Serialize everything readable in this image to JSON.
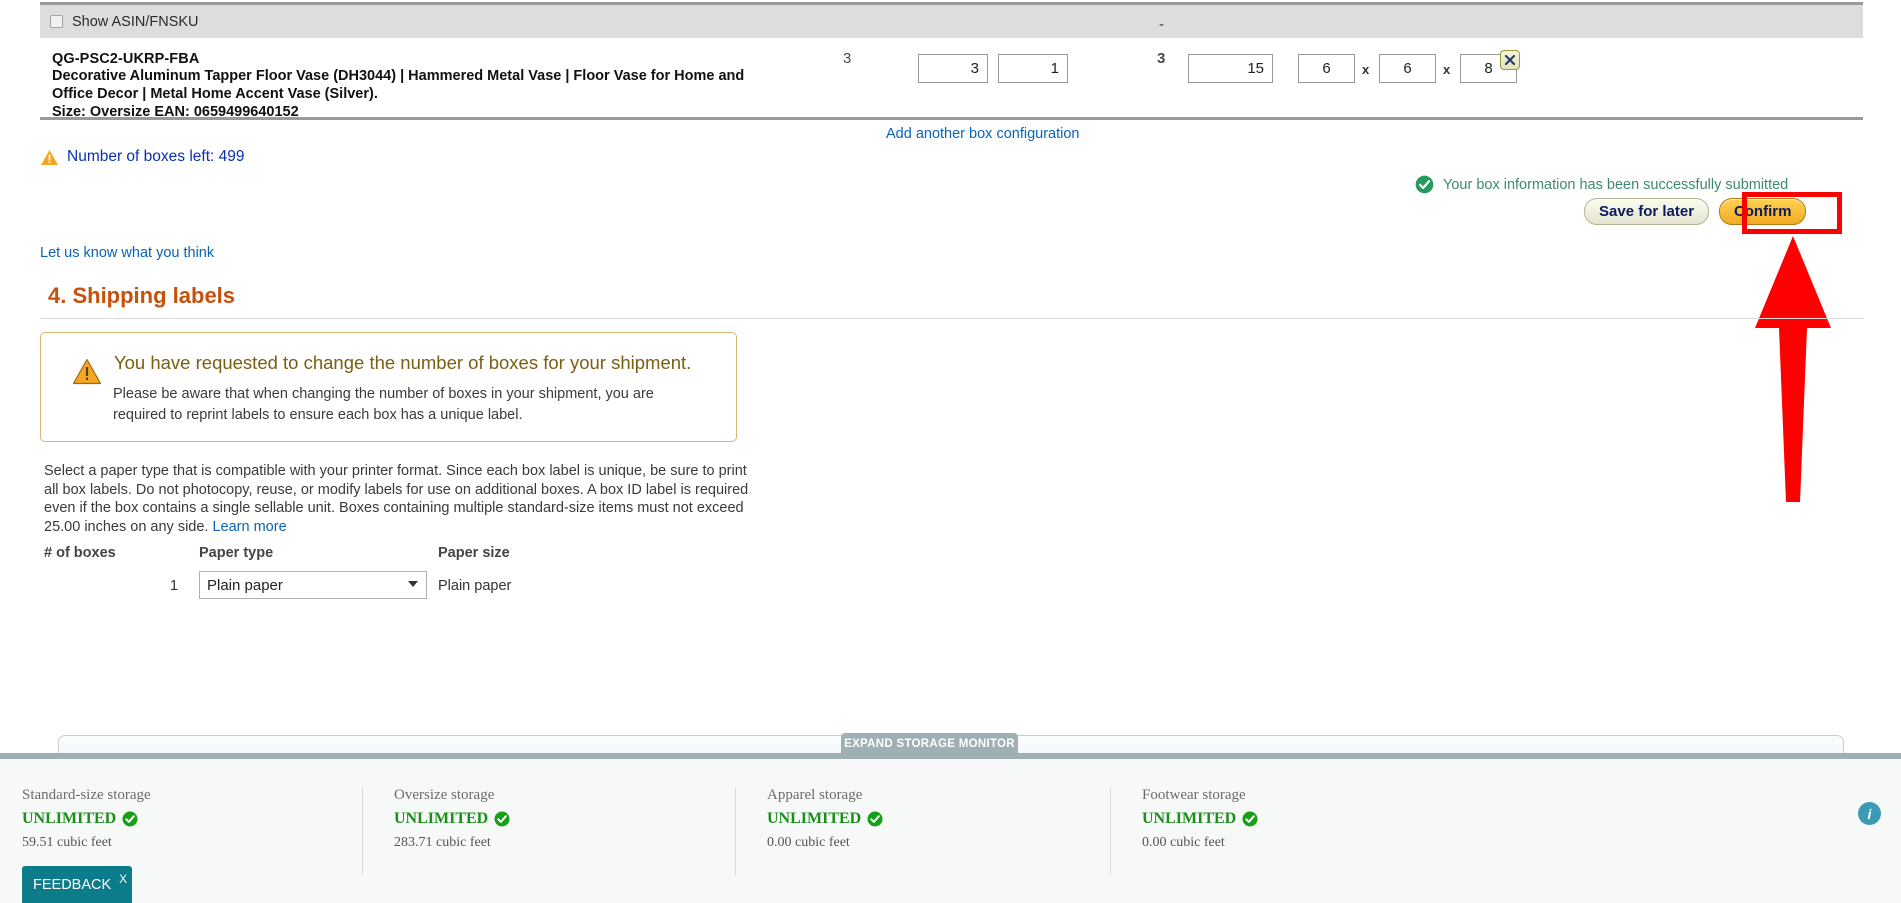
{
  "header_row": {
    "show_asin_label": "Show ASIN/FNSKU",
    "dash": "-"
  },
  "product_row": {
    "sku": "QG-PSC2-UKRP-FBA",
    "title": "Decorative Aluminum Tapper Floor Vase (DH3044) | Hammered Metal Vase | Floor Vase for Home and Office Decor | Metal Home Accent Vase (Silver).",
    "size_line": "Size: Oversize EAN: 0659499640152",
    "boxes_total": "3",
    "boxes_qty": "3",
    "units_per_box": "1",
    "add_config_link": "Add another box configuration",
    "units_total": "3",
    "weight": "15",
    "dim_length": "6",
    "dim_width": "6",
    "dim_height": "8",
    "x_sep": "x",
    "delete_title": "Remove box configuration"
  },
  "boxes_left": {
    "text": "Number of boxes left: 499"
  },
  "status": {
    "success_text": "Your box information has been successfully submitted"
  },
  "actions": {
    "save_for_later": "Save for later",
    "confirm": "Confirm"
  },
  "feedback_link": "Let us know what you think",
  "section4": {
    "title": "4. Shipping labels",
    "alert": {
      "heading": "You have requested to change the number of boxes for your shipment.",
      "body": "Please be aware that when changing the number of boxes in your shipment, you are required to reprint labels to ensure each box has a unique label."
    },
    "paragraph": "Select a paper type that is compatible with your printer format. Since each box label is unique, be sure to print all box labels. Do not photocopy, reuse, or modify labels for use on additional boxes. A box ID label is required even if the box contains a single sellable unit. Boxes containing multiple standard-size items must not exceed 25.00 inches on any side. ",
    "learn_more": "Learn more",
    "table": {
      "headers": [
        "# of boxes",
        "Paper type",
        "Paper size"
      ],
      "num_boxes": "1",
      "paper_type_selected": "Plain paper",
      "paper_size_value": "Plain paper"
    }
  },
  "storage_monitor": {
    "expand_tab": "EXPAND STORAGE MONITOR",
    "columns": [
      {
        "label": "Standard-size storage",
        "value": "UNLIMITED",
        "sub": "59.51 cubic feet"
      },
      {
        "label": "Oversize storage",
        "value": "UNLIMITED",
        "sub": "283.71 cubic feet"
      },
      {
        "label": "Apparel storage",
        "value": "UNLIMITED",
        "sub": "0.00 cubic feet"
      },
      {
        "label": "Footwear storage",
        "value": "UNLIMITED",
        "sub": "0.00 cubic feet"
      }
    ],
    "info_glyph": "i"
  },
  "feedback_tab": {
    "label": "FEEDBACK",
    "close": "X"
  },
  "colors": {
    "accent_orange": "#c8500a",
    "link_blue": "#0a63b5",
    "success_green": "#3d8b6e",
    "annotation_red": "#ff0000",
    "confirm_yellow": "#f3ab21"
  }
}
